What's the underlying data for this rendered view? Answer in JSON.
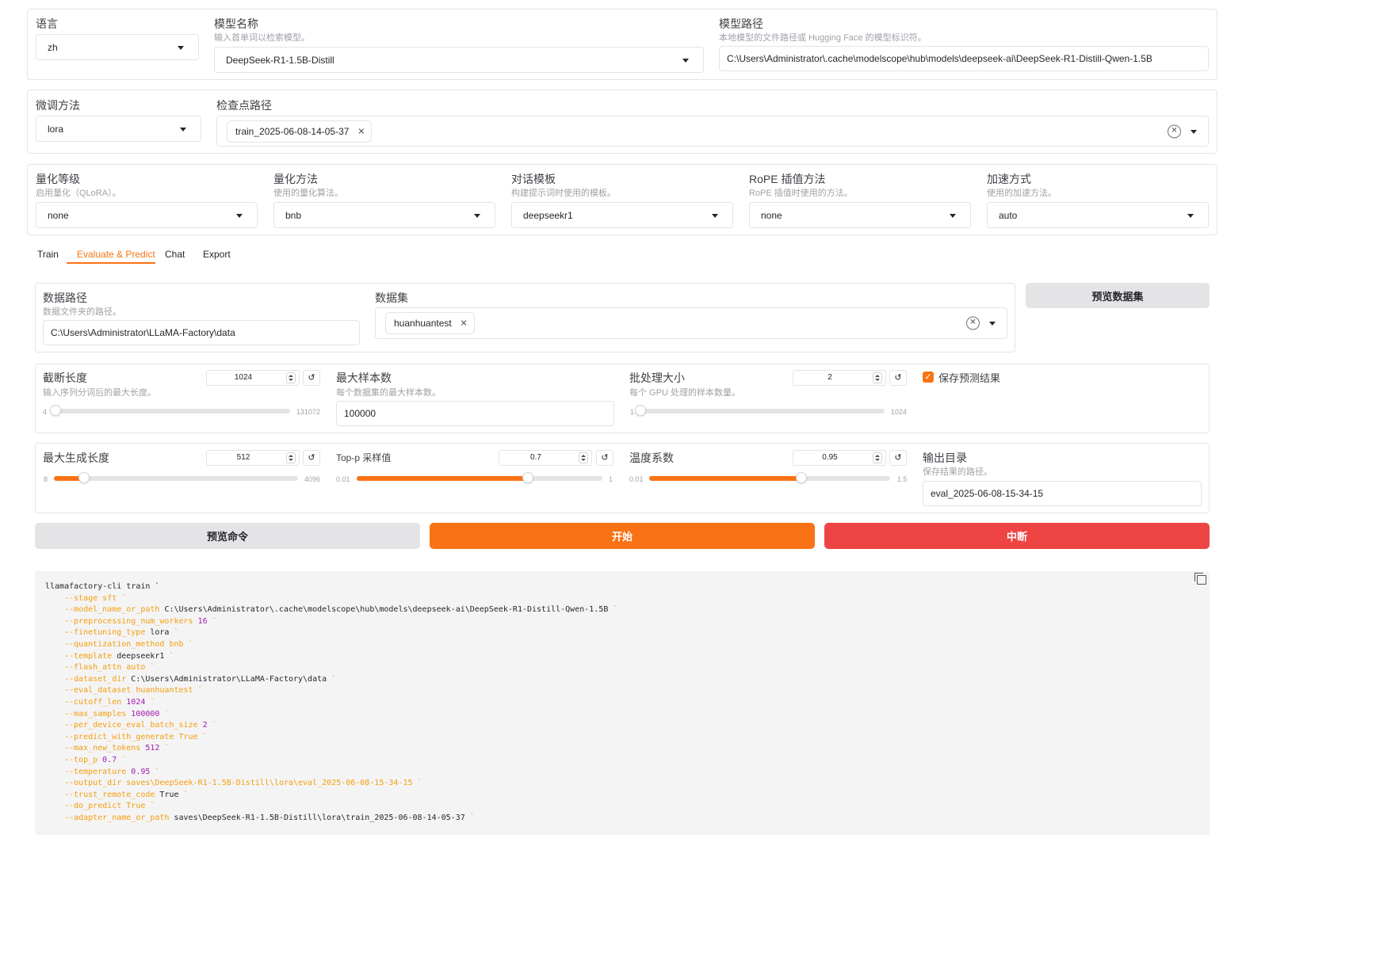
{
  "top": {
    "language": {
      "label": "语言",
      "value": "zh"
    },
    "model_name": {
      "label": "模型名称",
      "info": "输入首单词以检索模型。",
      "value": "DeepSeek-R1-1.5B-Distill"
    },
    "model_path": {
      "label": "模型路径",
      "info": "本地模型的文件路径或 Hugging Face 的模型标识符。",
      "value": "C:\\Users\\Administrator\\.cache\\modelscope\\hub\\models\\deepseek-ai\\DeepSeek-R1-Distill-Qwen-1.5B"
    },
    "finetuning": {
      "label": "微调方法",
      "value": "lora"
    },
    "checkpoint": {
      "label": "检查点路径",
      "chip": "train_2025-06-08-14-05-37"
    },
    "quant_bit": {
      "label": "量化等级",
      "info": "启用量化（QLoRA）。",
      "value": "none"
    },
    "quant_method": {
      "label": "量化方法",
      "info": "使用的量化算法。",
      "value": "bnb"
    },
    "template": {
      "label": "对话模板",
      "info": "构建提示词时使用的模板。",
      "value": "deepseekr1"
    },
    "rope": {
      "label": "RoPE 插值方法",
      "info": "RoPE 插值时使用的方法。",
      "value": "none"
    },
    "booster": {
      "label": "加速方式",
      "info": "使用的加速方法。",
      "value": "auto"
    }
  },
  "tabs": [
    "Train",
    "Evaluate & Predict",
    "Chat",
    "Export"
  ],
  "active_tab": "Evaluate & Predict",
  "eval": {
    "dataset_dir": {
      "label": "数据路径",
      "info": "数据文件夹的路径。",
      "value": "C:\\Users\\Administrator\\LLaMA-Factory\\data"
    },
    "dataset": {
      "label": "数据集",
      "chip": "huanhuantest"
    },
    "preview_dataset": "预览数据集",
    "cutoff_len": {
      "label": "截断长度",
      "info": "输入序列分词后的最大长度。",
      "value": "1024",
      "min": "4",
      "max": "131072",
      "fraction": 0.0078
    },
    "max_samples": {
      "label": "最大样本数",
      "info": "每个数据集的最大样本数。",
      "value": "100000"
    },
    "batch_size": {
      "label": "批处理大小",
      "info": "每个 GPU 处理的样本数量。",
      "value": "2",
      "min": "1",
      "max": "1024",
      "fraction": 0.001
    },
    "predict": {
      "label": "保存预测结果",
      "checked": true
    },
    "max_new_tokens": {
      "label": "最大生成长度",
      "value": "512",
      "min": "8",
      "max": "4096",
      "fraction": 0.123
    },
    "top_p": {
      "label": "Top-p 采样值",
      "value": "0.7",
      "min": "0.01",
      "max": "1",
      "fraction": 0.697
    },
    "temperature": {
      "label": "温度系数",
      "value": "0.95",
      "min": "0.01",
      "max": "1.5",
      "fraction": 0.631
    },
    "output_dir": {
      "label": "输出目录",
      "info": "保存结果的路径。",
      "value": "eval_2025-06-08-15-34-15"
    }
  },
  "buttons": {
    "preview_cmd": "预览命令",
    "start": "开始",
    "abort": "中断"
  },
  "colors": {
    "accent": "#f97316",
    "danger": "#ef4444",
    "neutral": "#e4e4e7"
  },
  "command": {
    "head": "llamafactory-cli train `",
    "lines": [
      {
        "flag": "--stage",
        "value": "sft",
        "kind": "flag"
      },
      {
        "flag": "--model_name_or_path",
        "value": "C:\\Users\\Administrator\\.cache\\modelscope\\hub\\models\\deepseek-ai\\DeepSeek-R1-Distill-Qwen-1.5B",
        "kind": "dflt"
      },
      {
        "flag": "--preprocessing_num_workers",
        "value": "16",
        "kind": "num2"
      },
      {
        "flag": "--finetuning_type",
        "value": "lora",
        "kind": "dflt"
      },
      {
        "flag": "--quantization_method",
        "value": "bnb",
        "kind": "flag"
      },
      {
        "flag": "--template",
        "value": "deepseekr1",
        "kind": "dflt"
      },
      {
        "flag": "--flash_attn",
        "value": "auto",
        "kind": "flag"
      },
      {
        "flag": "--dataset_dir",
        "value": "C:\\Users\\Administrator\\LLaMA-Factory\\data",
        "kind": "dflt"
      },
      {
        "flag": "--eval_dataset",
        "value": "huanhuantest",
        "kind": "flag"
      },
      {
        "flag": "--cutoff_len",
        "value": "1024",
        "kind": "num2"
      },
      {
        "flag": "--max_samples",
        "value": "100000",
        "kind": "num2"
      },
      {
        "flag": "--per_device_eval_batch_size",
        "value": "2",
        "kind": "num2"
      },
      {
        "flag": "--predict_with_generate",
        "value": "True",
        "kind": "flag"
      },
      {
        "flag": "--max_new_tokens",
        "value": "512",
        "kind": "num2"
      },
      {
        "flag": "--top_p",
        "value": "0.7",
        "kind": "num2"
      },
      {
        "flag": "--temperature",
        "value": "0.95",
        "kind": "num2"
      },
      {
        "flag": "--output_dir",
        "value": "saves\\DeepSeek-R1-1.5B-Distill\\lora\\eval_2025-06-08-15-34-15",
        "kind": "flag"
      },
      {
        "flag": "--trust_remote_code",
        "value": "True",
        "kind": "dflt"
      },
      {
        "flag": "--do_predict",
        "value": "True",
        "kind": "flag"
      },
      {
        "flag": "--adapter_name_or_path",
        "value": "saves\\DeepSeek-R1-1.5B-Distill\\lora\\train_2025-06-08-14-05-37",
        "kind": "dflt"
      }
    ]
  }
}
